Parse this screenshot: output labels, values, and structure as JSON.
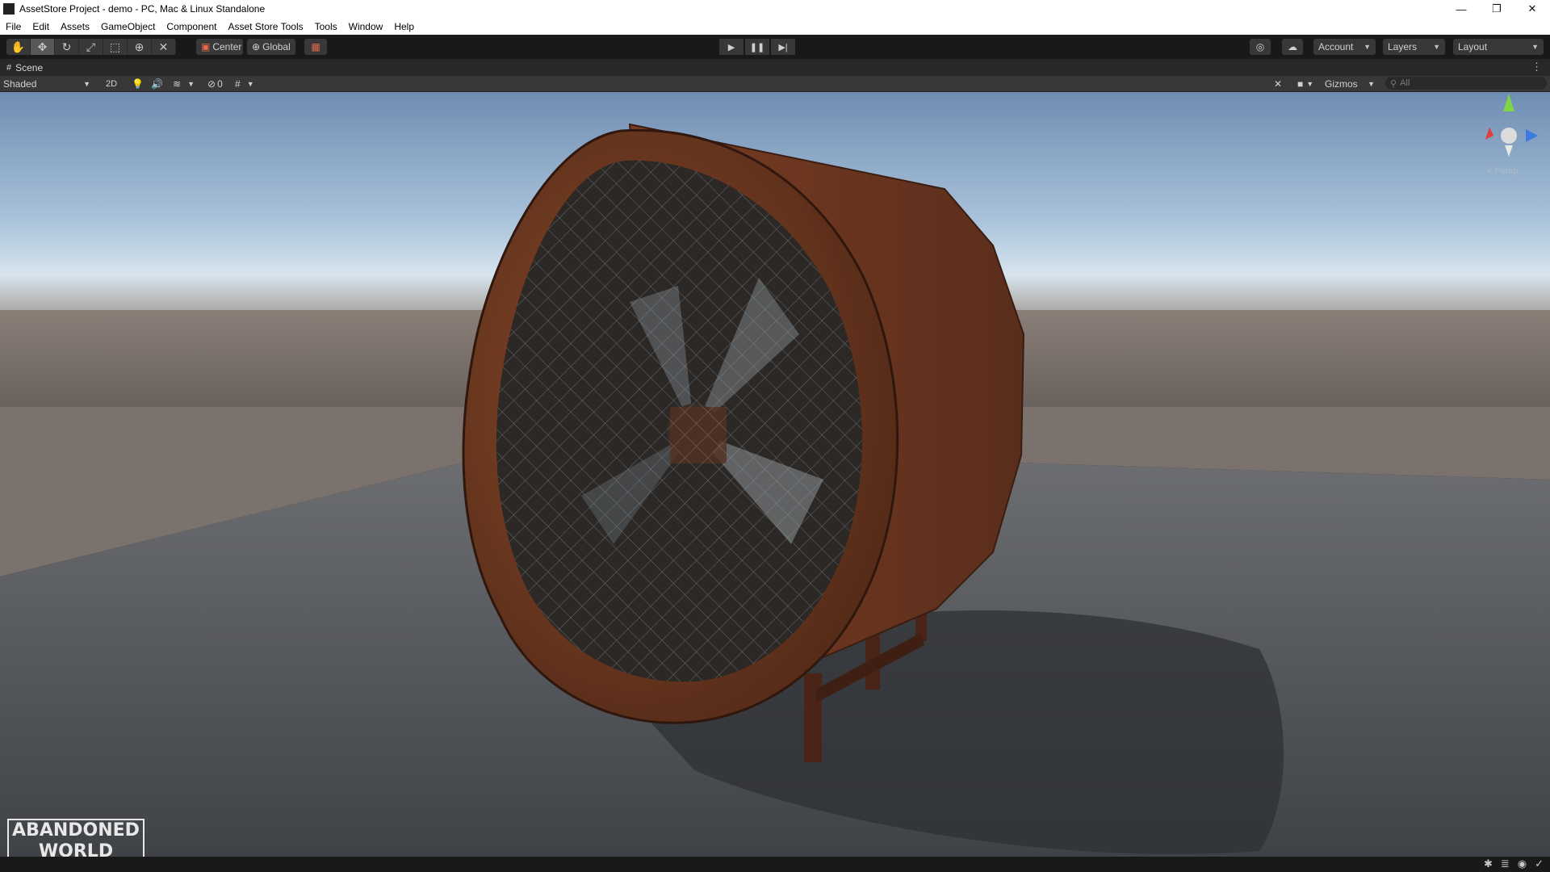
{
  "window": {
    "title": "AssetStore Project - demo - PC, Mac & Linux Standalone",
    "controls": [
      "—",
      "❐",
      "✕"
    ]
  },
  "menu": [
    "File",
    "Edit",
    "Assets",
    "GameObject",
    "Component",
    "Asset Store Tools",
    "Tools",
    "Window",
    "Help"
  ],
  "toolbar": {
    "tools": [
      "hand-tool",
      "move-tool",
      "rotate-tool",
      "scale-tool",
      "rect-tool",
      "transform-tool",
      "custom-editor-tool"
    ],
    "active_tool": "move-tool",
    "pivot_label": "Center",
    "space_label": "Global",
    "account_label": "Account",
    "layers_label": "Layers",
    "layout_label": "Layout"
  },
  "scene_tab": {
    "label": "Scene"
  },
  "scene_toolbar": {
    "draw_mode": "Shaded",
    "mode_2d": "2D",
    "hidden_count": "0",
    "gizmos_label": "Gizmos",
    "search_placeholder": "All"
  },
  "orientation_gizmo": {
    "persp_label": "< Persp",
    "axes": [
      "y",
      "x",
      "z"
    ]
  },
  "watermark": {
    "line1": "ABANDONED",
    "line2": "WORLD"
  },
  "colors": {
    "sky_top": "#6f8db3",
    "horizon": "#c8dceb",
    "ground": "#54575b",
    "rust": "#7a3c22",
    "toolbar_bg": "#191919",
    "button_bg": "#383838"
  }
}
